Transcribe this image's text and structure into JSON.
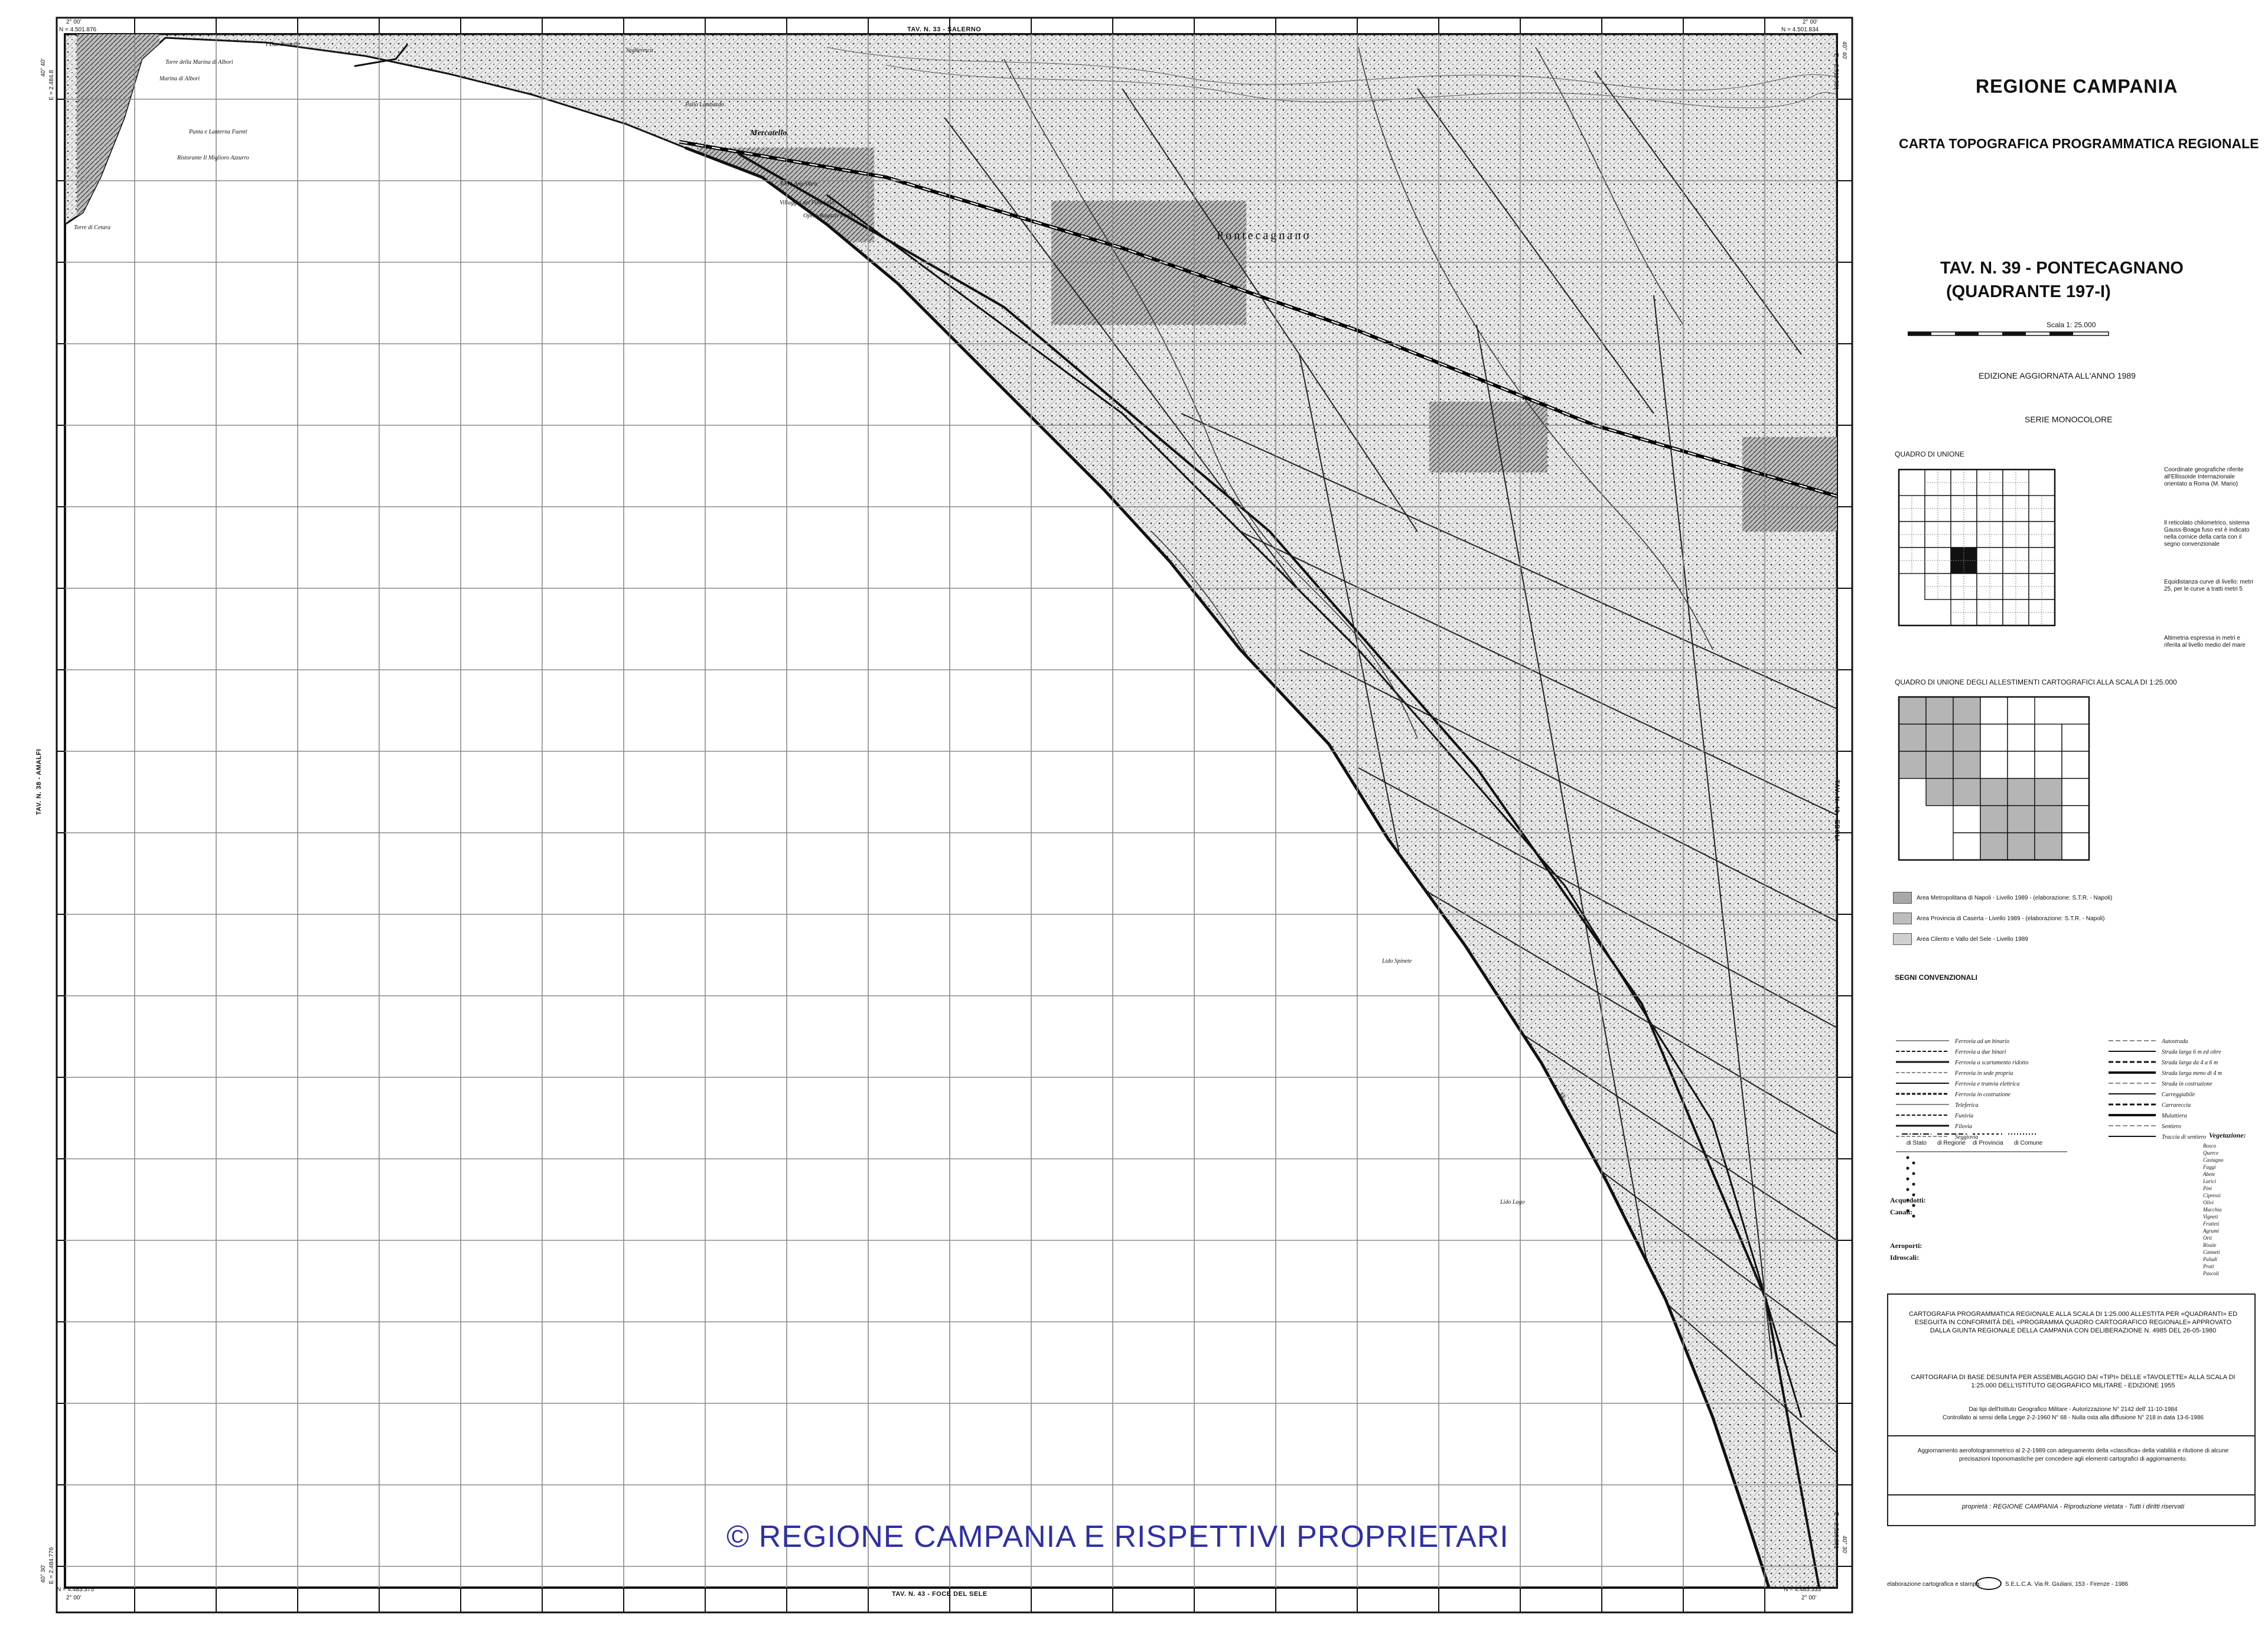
{
  "map": {
    "top_sheet": "TAV. N. 33 - SALERNO",
    "bottom_sheet": "TAV. N. 43 - FOCE DEL SELE",
    "left_sheet": "TAV. N. 38 - AMALFI",
    "right_sheet": "TAV. N. 40 - EBOLI",
    "corner_tl_lon": "2° 00'",
    "corner_tl_north": "N = 4.501.876",
    "corner_tr_lon": "2° 00'",
    "corner_tr_north": "N = 4.501.834",
    "corner_bl_north": "N = 4.483.375",
    "corner_bl_lon": "2° 00'",
    "corner_br_north": "N = 4.483.333",
    "corner_br_lon": "2° 00'",
    "left_top_lat": "40° 40'",
    "left_top_east": "E = 2.484.8",
    "right_top_lat": "40° 40'",
    "right_top_east": "E = 2.510.901",
    "left_bottom_lat": "40° 30'",
    "left_bottom_east": "E = 2.484.776",
    "right_bottom_lat": "40° 30'",
    "right_bottom_east": "E = 2.510.861",
    "places": [
      "Torre della Marina di Albori",
      "Marina di Albori",
      "Punta e Lanterna Fuenti",
      "Ristorante Il Miglioro Azzurro",
      "Torre di Cetara",
      "I Due Fratelli",
      "Seglieresca",
      "Pallo Lambardo",
      "Mercatello",
      "Torre Angellara",
      "Villaggio del Fanciullo",
      "Opera Ragazzi Poveri",
      "Pontecagnano",
      "Lido Spinete",
      "Lido Lago"
    ]
  },
  "watermark": "© REGIONE CAMPANIA E RISPETTIVI PROPRIETARI",
  "legend": {
    "region": "REGIONE CAMPANIA",
    "subtitle": "CARTA TOPOGRAFICA PROGRAMMATICA REGIONALE",
    "tav_line1": "TAV. N. 39 - PONTECAGNANO",
    "tav_line2": "(QUADRANTE 197-I)",
    "scale": "Scala 1: 25.000",
    "edition": "EDIZIONE AGGIORNATA ALL'ANNO 1989",
    "series": "SERIE MONOCOLORE",
    "index_title": "QUADRO DI UNIONE",
    "index_notes": [
      "Coordinate geografiche riferite all'Ellissoide Internazionale orientato a Roma (M. Mario)",
      "Il reticolato chilometrico, sistema Gauss-Boaga fuso est è indicato nella cornice della carta con il segno convenzionale",
      "Equidistanza curve di livello: metri 25, per le curve a tratti metri 5",
      "Altimetria espressa in metri e riferita al livello medio del mare"
    ],
    "index2_title": "QUADRO DI UNIONE DEGLI ALLESTIMENTI CARTOGRAFICI ALLA SCALA DI 1:25.000",
    "areas": [
      "Area Metropolitana di Napoli - Livello 1989 - (elaborazione: S.T.R. - Napoli)",
      "Area Provincia di Caserta - Livello 1989 - (elaborazione: S.T.R. - Napoli)",
      "Area Cilento e Vallo del Sele - Livello 1989"
    ],
    "signs_title": "SEGNI CONVENZIONALI",
    "signs_left": [
      "Ferrovia ad un binario",
      "Ferrovia a due binari",
      "Ferrovia a scartamento ridotto",
      "Ferrovia in sede propria",
      "Ferrovia e tranvia elettrica",
      "Ferrovia in costruzione",
      "Teleferica",
      "Funivia",
      "Filovia",
      "Seggiovia"
    ],
    "signs_right": [
      "Autostrada",
      "Strada larga 6 m ed oltre",
      "Strada larga da 4 a 6 m",
      "Strada larga meno di 4 m",
      "Strada in costruzione",
      "Carreggiabile",
      "Carrareccia",
      "Mulattiera",
      "Sentiero",
      "Traccia di sentiero"
    ],
    "limits": [
      "di Stato",
      "di Regione",
      "di Provincia",
      "di Comune"
    ],
    "acquedotti": "Acquedotti:",
    "canali": "Canali:",
    "aeroporti": "Aeroporti:",
    "idroscali": "Idroscali:",
    "vegetation_title": "Vegetazione:",
    "vegetation": [
      "Bosco",
      "Querce",
      "Castagno",
      "Faggi",
      "Abete",
      "Larici",
      "Pini",
      "Cipressi",
      "Olivi",
      "Macchia",
      "Vigneti",
      "Frutteti",
      "Agrumi",
      "Orti",
      "Risaie",
      "Canneti",
      "Paludi",
      "Prati",
      "Pascoli"
    ],
    "note1": "CARTOGRAFIA PROGRAMMATICA REGIONALE ALLA SCALA DI 1:25.000 ALLESTITA PER «QUADRANTI» ED ESEGUITA IN CONFORMITÀ DEL «PROGRAMMA QUADRO CARTOGRAFICO REGIONALE» APPROVATO DALLA GIUNTA REGIONALE DELLA CAMPANIA CON DELIBERAZIONE N. 4985 DEL 26-05-1980",
    "note2": "CARTOGRAFIA DI BASE DESUNTA PER ASSEMBLAGGIO DAI «TIPI» DELLE «TAVOLETTE» ALLA SCALA DI 1:25.000 DELL'ISTITUTO GEOGRAFICO MILITARE - EDIZIONE 1955",
    "note3": "Dai tipi dell'Istituto Geografico Militare - Autorizzazione N° 2142 dell' 11-10-1984",
    "note3b": "Controllato ai sensi della Legge 2-2-1960 N° 68 - Nulla osta alla diffusione N° 218 in data 13-6-1986",
    "note4": "Aggiornamento aerofotogrammetrico al 2-2-1989 con adeguamento della «classifica» della viabilità e rilutione di alcune precisazioni toponomastiche per concedere agli elementi cartografici di aggiornamento.",
    "rights": "proprietà : REGIONE CAMPANIA - Riproduzione vietata - Tutti i diritti riservati",
    "printer_label": "elaborazione cartografica e stampa:",
    "printer": "S.E.L.C.A. Via R. Giuliani, 153 - Firenze - 1986"
  }
}
